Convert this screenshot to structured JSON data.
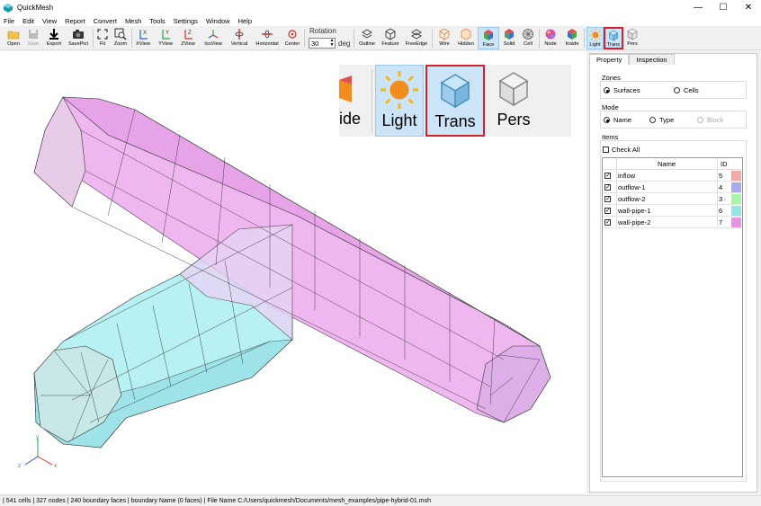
{
  "window": {
    "title": "QuickMesh",
    "minimize": "—",
    "maximize": "☐",
    "close": "✕"
  },
  "menu": [
    "File",
    "Edit",
    "View",
    "Report",
    "Convert",
    "Mesh",
    "Tools",
    "Settings",
    "Window",
    "Help"
  ],
  "toolbar": {
    "open": "Open",
    "save": "Save",
    "export": "Export",
    "savepict": "SavePict",
    "fit": "Fit",
    "zoom": "Zoom",
    "xview": "XView",
    "yview": "YView",
    "zview": "ZView",
    "isoview": "IsoView",
    "vertical": "Vertical",
    "horizontal": "Horizontal",
    "center": "Center",
    "rotation_label": "Rotation",
    "rotation_value": "30",
    "rotation_unit": "deg",
    "outline": "Outline",
    "feature": "Feature",
    "freeedge": "FreeEdge",
    "wire": "Wire",
    "hidden": "Hidden",
    "face": "Face",
    "solid": "Solid",
    "cell": "Cell",
    "node": "Node",
    "inside": "Inside",
    "light": "Light",
    "trans": "Trans",
    "pers": "Pers"
  },
  "inset": {
    "partial": "ide",
    "light": "Light",
    "trans": "Trans",
    "pers": "Pers"
  },
  "axes": {
    "x": "x",
    "y": "y",
    "z": "z"
  },
  "panel": {
    "tabs": [
      "Property",
      "Inspection"
    ],
    "zones_label": "Zones",
    "zones_surfaces": "Surfaces",
    "zones_cells": "Cells",
    "mode_label": "Mode",
    "mode_name": "Name",
    "mode_type": "Type",
    "mode_block": "Block",
    "items_label": "Items",
    "check_all": "Check All",
    "col_name": "Name",
    "col_id": "ID",
    "rows": [
      {
        "name": "inflow",
        "id": "5",
        "color": "#f4a9a9"
      },
      {
        "name": "outflow-1",
        "id": "4",
        "color": "#a9a9f4"
      },
      {
        "name": "outflow-2",
        "id": "3",
        "color": "#a9f4a9"
      },
      {
        "name": "wall-pipe-1",
        "id": "6",
        "color": "#93e6e6"
      },
      {
        "name": "wall-pipe-2",
        "id": "7",
        "color": "#e693e6"
      }
    ]
  },
  "status": "| 541 cells | 327 nodes | 240 boundary faces |  boundary Name  (0 faces) | File Name C:/Users/quickmesh/Documents/mesh_examples/pipe-hybrid-01.msh"
}
